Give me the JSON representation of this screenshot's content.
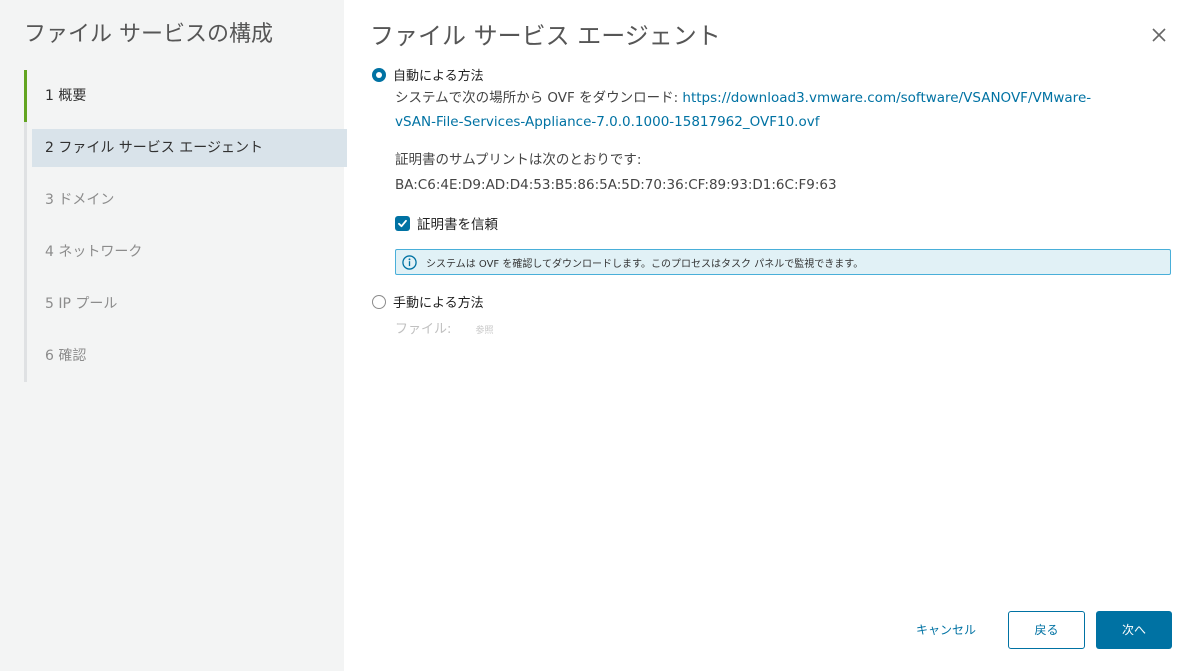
{
  "sidebar": {
    "title": "ファイル サービスの構成",
    "steps": [
      {
        "label": "1 概要",
        "state": "done"
      },
      {
        "label": "2 ファイル サービス エージェント",
        "state": "current"
      },
      {
        "label": "3 ドメイン",
        "state": "todo"
      },
      {
        "label": "4 ネットワーク",
        "state": "todo"
      },
      {
        "label": "5 IP プール",
        "state": "todo"
      },
      {
        "label": "6 確認",
        "state": "todo"
      }
    ]
  },
  "main": {
    "title": "ファイル サービス エージェント",
    "automatic": {
      "label": "自動による方法",
      "selected": true,
      "download_prefix": "システムで次の場所から OVF をダウンロード: ",
      "download_url_line1": "https://download3.vmware.com/software/VSANOVF/VMware-",
      "download_url_line2": "vSAN-File-Services-Appliance-7.0.0.1000-15817962_OVF10.ovf",
      "thumbprint_label": "証明書のサムプリントは次のとおりです:",
      "thumbprint_value": "BA:C6:4E:D9:AD:D4:53:B5:86:5A:5D:70:36:CF:89:93:D1:6C:F9:63",
      "trust_label": "証明書を信頼",
      "trust_checked": true,
      "info_message": "システムは OVF を確認してダウンロードします。このプロセスはタスク パネルで監視できます。"
    },
    "manual": {
      "label": "手動による方法",
      "selected": false,
      "file_label": "ファイル:",
      "browse_label": "参照"
    }
  },
  "footer": {
    "cancel_label": "キャンセル",
    "back_label": "戻る",
    "next_label": "次へ"
  },
  "colors": {
    "accent": "#0072a3",
    "progress": "#62a420",
    "current_step_bg": "#d9e3ea",
    "info_border": "#49afd9",
    "info_bg": "#e1f1f6"
  },
  "icons": {
    "close": "close-icon",
    "info": "info-circle-icon",
    "check": "check-icon"
  }
}
